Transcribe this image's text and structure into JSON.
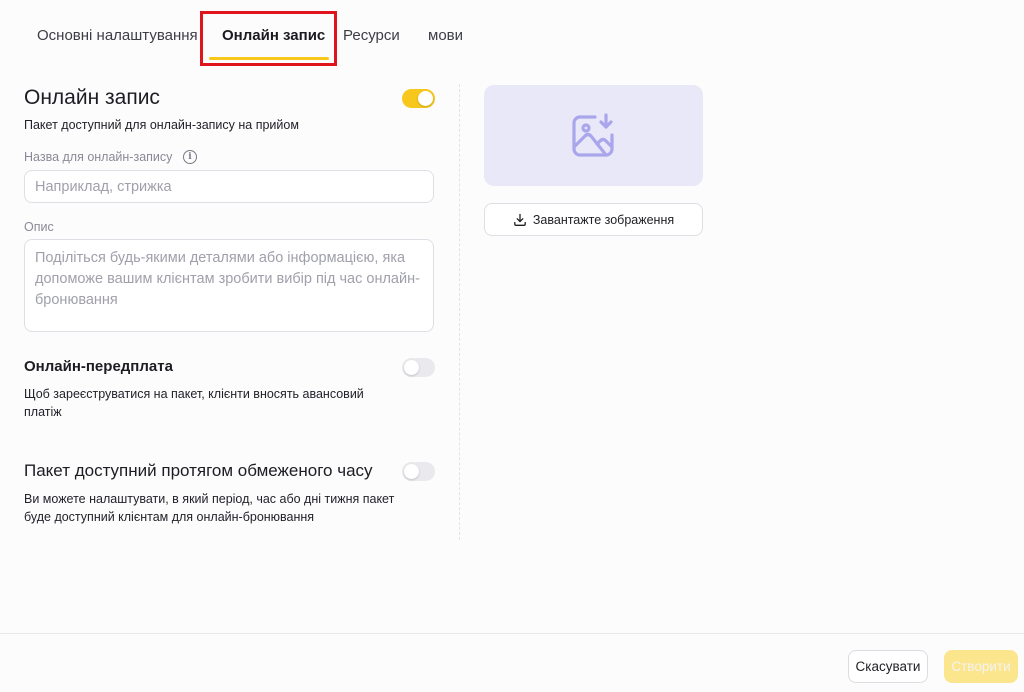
{
  "tabs": [
    {
      "label": "Основні налаштування"
    },
    {
      "label": "Онлайн запис",
      "active": true
    },
    {
      "label": "Ресурси"
    },
    {
      "label": "мови"
    }
  ],
  "online_booking": {
    "title": "Онлайн запис",
    "enabled": true,
    "subtitle": "Пакет доступний для онлайн-запису на прийом",
    "name_label": "Назва для онлайн-запису",
    "name_placeholder": "Наприклад, стрижка",
    "name_value": "",
    "description_label": "Опис",
    "description_placeholder": "Поділіться будь-якими деталями або інформацією, яка допоможе вашим клієнтам зробити вибір під час онлайн-бронювання",
    "description_value": ""
  },
  "prepayment": {
    "title": "Онлайн-передплата",
    "enabled": false,
    "description": "Щоб зареєструватися на пакет, клієнти вносять авансовий платіж"
  },
  "limited_time": {
    "title": "Пакет доступний протягом обмеженого часу",
    "enabled": false,
    "description": "Ви можете налаштувати, в який період, час або дні тижня пакет буде доступний клієнтам для онлайн-бронювання"
  },
  "image": {
    "icon": "image-download-icon",
    "upload_label": "Завантажте зображення"
  },
  "footer": {
    "cancel_label": "Скасувати",
    "create_label": "Створити"
  },
  "colors": {
    "accent": "#f7c71b",
    "highlight": "#e0141c",
    "image_placeholder_bg": "#e9e8f8",
    "image_icon": "#a9a6ec"
  }
}
